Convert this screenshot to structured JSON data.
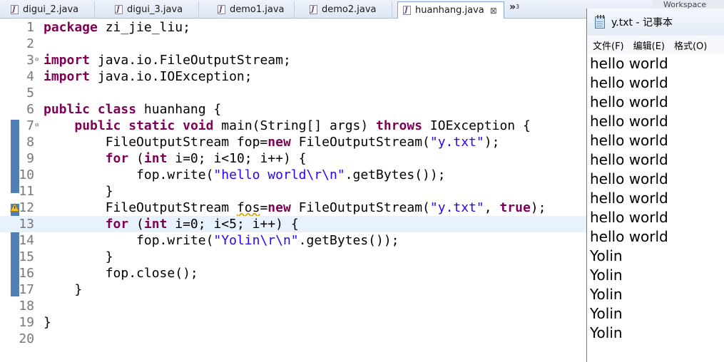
{
  "tabs": [
    {
      "label": "digui_2.java",
      "active": false
    },
    {
      "label": "digui_3.java",
      "active": false
    },
    {
      "label": "demo1.java",
      "active": false
    },
    {
      "label": "demo2.java",
      "active": false
    },
    {
      "label": "huanhang.java",
      "active": true,
      "close": "⊠"
    }
  ],
  "tab_overflow": {
    "chevron": "»",
    "count": "3"
  },
  "editor": {
    "line_numbers": [
      "1",
      "2",
      "3",
      "4",
      "5",
      "6",
      "7",
      "8",
      "9",
      "10",
      "11",
      "12",
      "13",
      "14",
      "15",
      "16",
      "17",
      "18",
      "19",
      "20"
    ],
    "lines": [
      [
        {
          "t": "package",
          "c": "kw"
        },
        {
          "t": " zi_jie_liu;",
          "c": ""
        }
      ],
      [],
      [
        {
          "t": "import",
          "c": "kw"
        },
        {
          "t": " java.io.FileOutputStream;",
          "c": ""
        }
      ],
      [
        {
          "t": "import",
          "c": "kw"
        },
        {
          "t": " java.io.IOException;",
          "c": ""
        }
      ],
      [],
      [
        {
          "t": "public",
          "c": "kw"
        },
        {
          "t": " ",
          "c": ""
        },
        {
          "t": "class",
          "c": "kw"
        },
        {
          "t": " huanhang {",
          "c": ""
        }
      ],
      [
        {
          "t": "    ",
          "c": ""
        },
        {
          "t": "public",
          "c": "kw"
        },
        {
          "t": " ",
          "c": ""
        },
        {
          "t": "static",
          "c": "kw"
        },
        {
          "t": " ",
          "c": ""
        },
        {
          "t": "void",
          "c": "kw"
        },
        {
          "t": " main(String[] args) ",
          "c": ""
        },
        {
          "t": "throws",
          "c": "kw"
        },
        {
          "t": " IOException {",
          "c": ""
        }
      ],
      [
        {
          "t": "        FileOutputStream fop=",
          "c": ""
        },
        {
          "t": "new",
          "c": "kw"
        },
        {
          "t": " FileOutputStream(",
          "c": ""
        },
        {
          "t": "\"y.txt\"",
          "c": "str"
        },
        {
          "t": ");",
          "c": ""
        }
      ],
      [
        {
          "t": "        ",
          "c": ""
        },
        {
          "t": "for",
          "c": "kw"
        },
        {
          "t": " (",
          "c": ""
        },
        {
          "t": "int",
          "c": "kw"
        },
        {
          "t": " i=0; i<10; i++) {",
          "c": ""
        }
      ],
      [
        {
          "t": "            fop.write(",
          "c": ""
        },
        {
          "t": "\"hello world\\r\\n\"",
          "c": "str"
        },
        {
          "t": ".getBytes());",
          "c": ""
        }
      ],
      [
        {
          "t": "        }",
          "c": ""
        }
      ],
      [
        {
          "t": "        FileOutputStream ",
          "c": ""
        },
        {
          "t": "fos",
          "c": "warn"
        },
        {
          "t": "=",
          "c": ""
        },
        {
          "t": "new",
          "c": "kw"
        },
        {
          "t": " FileOutputStream(",
          "c": ""
        },
        {
          "t": "\"y.txt\"",
          "c": "str"
        },
        {
          "t": ", ",
          "c": ""
        },
        {
          "t": "true",
          "c": "kw"
        },
        {
          "t": ");",
          "c": ""
        }
      ],
      [
        {
          "t": "        ",
          "c": ""
        },
        {
          "t": "for",
          "c": "kw"
        },
        {
          "t": " (",
          "c": ""
        },
        {
          "t": "int",
          "c": "kw"
        },
        {
          "t": " i=0; i<5; i++) {",
          "c": ""
        }
      ],
      [
        {
          "t": "            fop.write(",
          "c": ""
        },
        {
          "t": "\"Yolin\\r\\n\"",
          "c": "str"
        },
        {
          "t": ".getBytes());",
          "c": ""
        }
      ],
      [
        {
          "t": "        }",
          "c": ""
        }
      ],
      [
        {
          "t": "        fop.close();",
          "c": ""
        }
      ],
      [
        {
          "t": "    }",
          "c": ""
        }
      ],
      [],
      [
        {
          "t": "}",
          "c": ""
        }
      ],
      []
    ],
    "highlighted_line": "13",
    "fold_lines": [
      "3",
      "7"
    ],
    "warning_line": "12",
    "colors": {
      "keyword": "#7f0055",
      "string": "#2a00ff",
      "highlight": "#e8f2fe",
      "change_marker": "#4f7fb5"
    }
  },
  "notepad": {
    "title": "y.txt - 记事本",
    "menu": [
      "文件(F)",
      "编辑(E)",
      "格式(O)"
    ],
    "background_tab": "Workspace",
    "content": [
      "hello world",
      "hello world",
      "hello world",
      "hello world",
      "hello world",
      "hello world",
      "hello world",
      "hello world",
      "hello world",
      "hello world",
      "Yolin",
      "Yolin",
      "Yolin",
      "Yolin",
      "Yolin"
    ]
  }
}
